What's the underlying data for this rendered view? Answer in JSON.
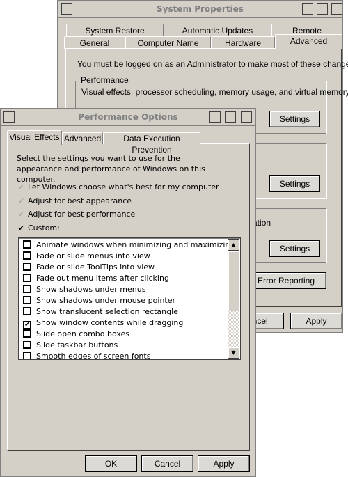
{
  "system_properties": {
    "title": "System Properties",
    "tabs_row1": [
      "System Restore",
      "Automatic Updates",
      "Remote"
    ],
    "tabs_row2": [
      "General",
      "Computer Name",
      "Hardware",
      "Advanced"
    ],
    "active_tab": "Advanced",
    "admin_note": "You must be logged on as an Administrator to make most of these changes.",
    "performance_label": "Performance",
    "performance_desc": "Visual effects, processor scheduling, memory usage, and virtual memory",
    "settings_label": "Settings",
    "partial_text": "ation",
    "error_reporting_label": "Error Reporting",
    "cancel_label": "ancel",
    "apply_label": "Apply"
  },
  "performance_options": {
    "title": "Performance Options",
    "tabs": [
      "Visual Effects",
      "Advanced",
      "Data Execution Prevention"
    ],
    "active_tab": "Visual Effects",
    "description": "Select the settings you want to use for the appearance and performance of Windows on this computer.",
    "options": [
      {
        "label": "Let Windows choose what's best for my computer",
        "selected": false
      },
      {
        "label": "Adjust for best appearance",
        "selected": false
      },
      {
        "label": "Adjust for best performance",
        "selected": false
      },
      {
        "label": "Custom:",
        "selected": true
      }
    ],
    "effects": [
      {
        "label": "Animate windows when minimizing and maximizing",
        "checked": false
      },
      {
        "label": "Fade or slide menus into view",
        "checked": false
      },
      {
        "label": "Fade or slide ToolTips into view",
        "checked": false
      },
      {
        "label": "Fade out menu items after clicking",
        "checked": false
      },
      {
        "label": "Show shadows under menus",
        "checked": false
      },
      {
        "label": "Show shadows under mouse pointer",
        "checked": false
      },
      {
        "label": "Show translucent selection rectangle",
        "checked": false
      },
      {
        "label": "Show window contents while dragging",
        "checked": true
      },
      {
        "label": "Slide open combo boxes",
        "checked": false
      },
      {
        "label": "Slide taskbar buttons",
        "checked": false
      },
      {
        "label": "Smooth edges of screen fonts",
        "checked": false
      }
    ],
    "ok_label": "OK",
    "cancel_label": "Cancel",
    "apply_label": "Apply"
  }
}
